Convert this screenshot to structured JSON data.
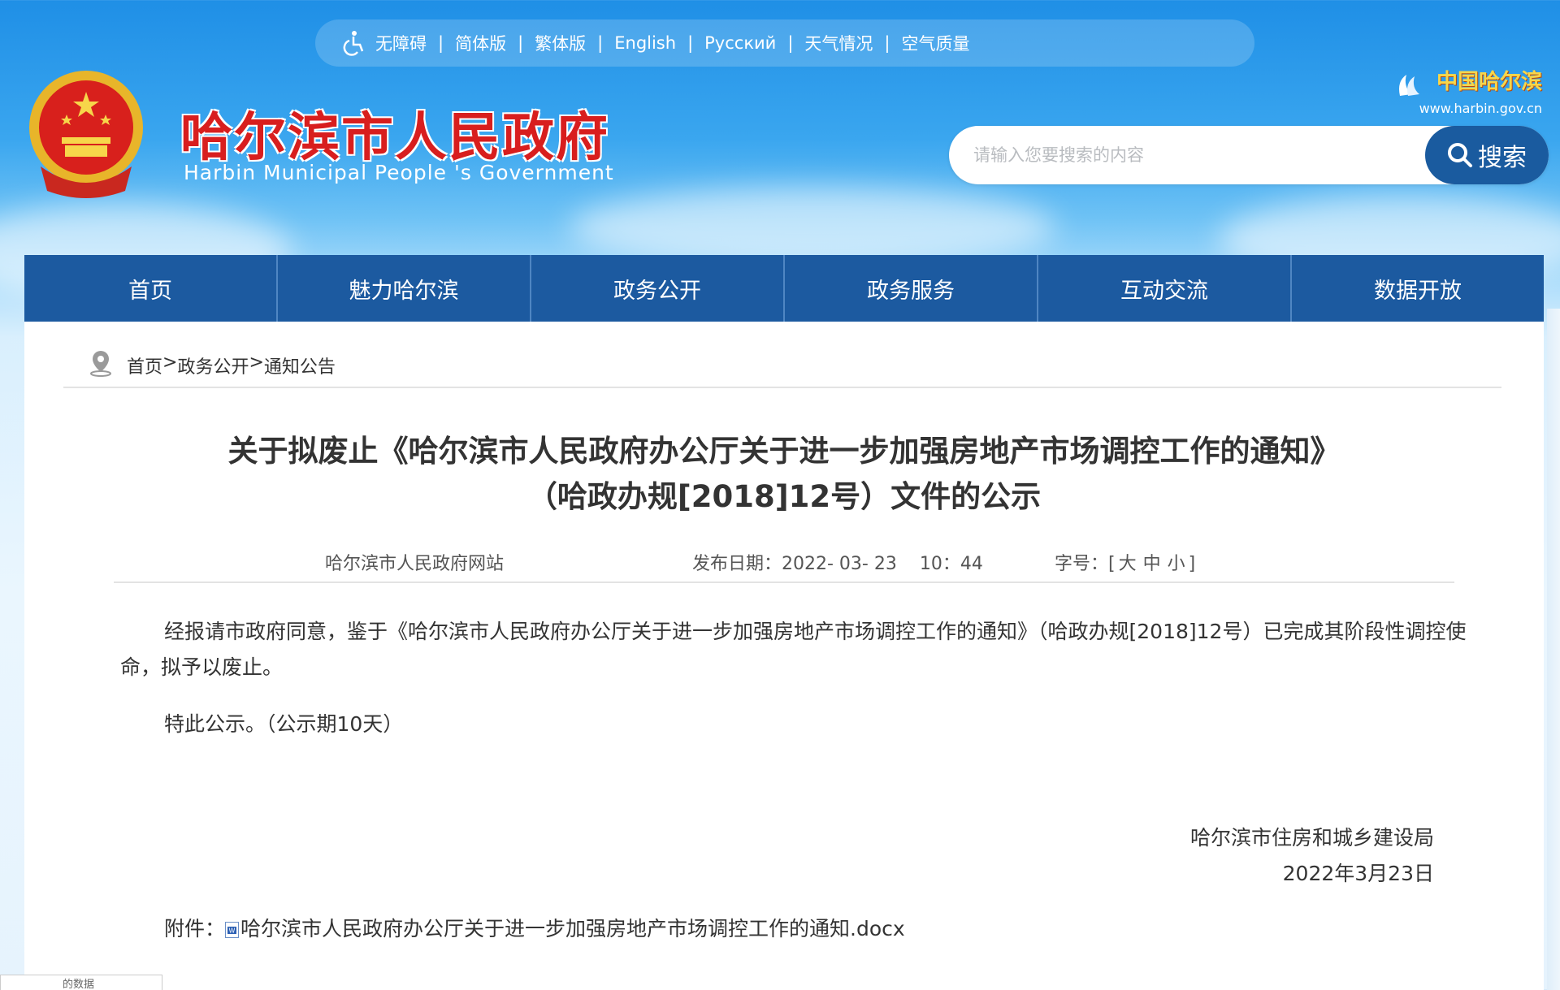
{
  "topbar": {
    "items": [
      "无障碍",
      "简体版",
      "繁体版",
      "English",
      "Русский",
      "天气情况",
      "空气质量"
    ],
    "separator": "|"
  },
  "header": {
    "title_cn": "哈尔滨市人民政府",
    "title_en": "Harbin Municipal People 's Government",
    "brand_zh": "中国哈尔滨",
    "brand_url": "www.harbin.gov.cn"
  },
  "search": {
    "placeholder": "请输入您要搜索的内容",
    "button_label": "搜索"
  },
  "nav": {
    "items": [
      "首页",
      "魅力哈尔滨",
      "政务公开",
      "政务服务",
      "互动交流",
      "数据开放"
    ]
  },
  "breadcrumb": {
    "items": [
      "首页",
      "政务公开",
      "通知公告"
    ],
    "sep": ">"
  },
  "article": {
    "title_line1": "关于拟废止《哈尔滨市人民政府办公厅关于进一步加强房地产市场调控工作的通知》",
    "title_line2": "（哈政办规[2018]12号）文件的公示",
    "source": "哈尔滨市人民政府网站",
    "date_label": "发布日期：",
    "date_value": "2022- 03- 23    10：44",
    "font_label": "字号：[",
    "font_large": "大",
    "font_medium": "中",
    "font_small": "小",
    "font_close": "]",
    "paragraph1": "经报请市政府同意，鉴于《哈尔滨市人民政府办公厅关于进一步加强房地产市场调控工作的通知》（哈政办规[2018]12号）已完成其阶段性调控使命，拟予以废止。",
    "paragraph2": "特此公示。（公示期10天）",
    "signature_org": "哈尔滨市住房和城乡建设局",
    "signature_date": "2022年3月23日",
    "attachment_label": "附件：",
    "attachment_name": "哈尔滨市人民政府办公厅关于进一步加强房地产市场调控工作的通知.docx"
  },
  "bottom_tab": {
    "label": "的数据"
  },
  "colors": {
    "nav_bg": "#1c5aa0",
    "title_red": "#d81e1e",
    "search_btn": "#1a5b9f"
  }
}
